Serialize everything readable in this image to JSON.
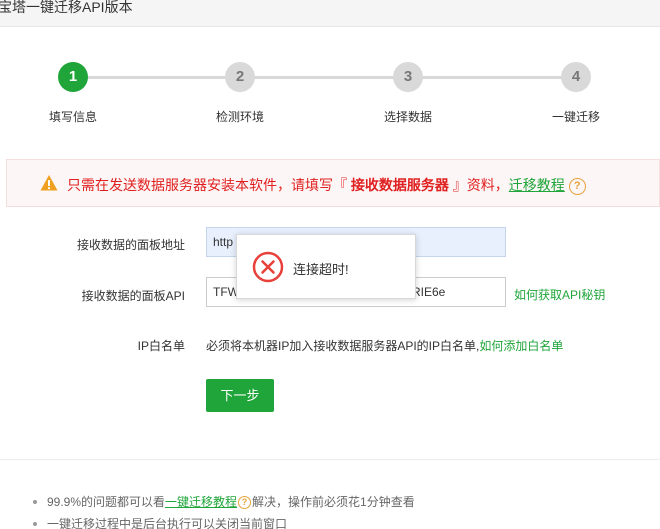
{
  "window": {
    "title": "宝塔一键迁移API版本"
  },
  "steps": [
    {
      "number": "1",
      "label": "填写信息",
      "active": true
    },
    {
      "number": "2",
      "label": "检测环境",
      "active": false
    },
    {
      "number": "3",
      "label": "选择数据",
      "active": false
    },
    {
      "number": "4",
      "label": "一键迁移",
      "active": false
    }
  ],
  "warning": {
    "prefix": "只需在发送数据服务器安装本软件，请填写『",
    "highlight": " 接收数据服务器 ",
    "suffix": "』资料，",
    "link": "迁移教程",
    "help": "?"
  },
  "form": {
    "panel_url_label": "接收数据的面板地址",
    "panel_url_value": "http",
    "panel_api_label": "接收数据的面板API",
    "panel_api_value_start": "TFW",
    "panel_api_value_end": "RIE6e",
    "api_key_link": "如何获取API秘钥",
    "ip_whitelist_label": "IP白名单",
    "ip_whitelist_text": "必须将本机器IP加入接收数据服务器API的IP白名单,",
    "ip_whitelist_link": "如何添加白名单",
    "next_button": "下一步"
  },
  "toast": {
    "message": "连接超时!"
  },
  "tips": {
    "line1_prefix": "99.9%的问题都可以看",
    "line1_link": "一键迁移教程",
    "line1_help": "?",
    "line1_suffix": "解决，操作前必须花1分钟查看",
    "line2": "一键迁移过程中是后台执行可以关闭当前窗口"
  },
  "colors": {
    "accent": "#20a53a",
    "warning": "#e02020",
    "help": "#e6a23c",
    "error": "#e8403a"
  }
}
